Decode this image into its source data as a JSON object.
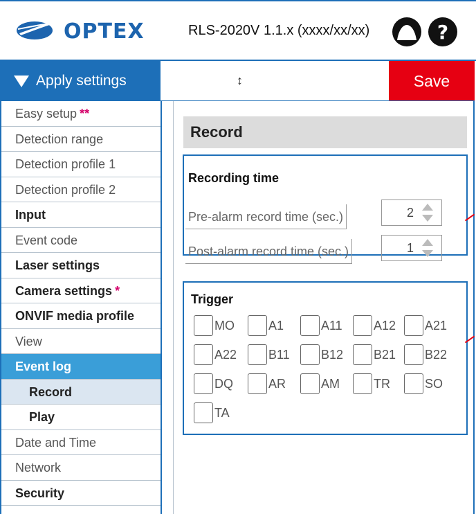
{
  "brand": {
    "name": "OPTEX",
    "color": "#1d64ae"
  },
  "header": {
    "model_version": "RLS-2020V 1.1.x (xxxx/xx/xx)"
  },
  "toolbar": {
    "apply_label": "Apply settings",
    "resize_glyph": "↕",
    "save_label": "Save"
  },
  "sidebar": {
    "items": [
      {
        "label": "Easy setup",
        "mark": "**",
        "style": "normal"
      },
      {
        "label": "Detection range",
        "mark": "",
        "style": "normal"
      },
      {
        "label": "Detection profile 1",
        "mark": "",
        "style": "normal"
      },
      {
        "label": "Detection profile 2",
        "mark": "",
        "style": "normal"
      },
      {
        "label": "Input",
        "mark": "",
        "style": "bold"
      },
      {
        "label": "Event code",
        "mark": "",
        "style": "normal"
      },
      {
        "label": "Laser settings",
        "mark": "",
        "style": "bold"
      },
      {
        "label": "Camera settings",
        "mark": "*",
        "style": "bold"
      },
      {
        "label": "ONVIF media profile",
        "mark": "",
        "style": "bold"
      },
      {
        "label": "View",
        "mark": "",
        "style": "normal"
      },
      {
        "label": "Event log",
        "mark": "",
        "style": "active"
      },
      {
        "label": "Record",
        "mark": "",
        "style": "sub-selected"
      },
      {
        "label": "Play",
        "mark": "",
        "style": "sub"
      },
      {
        "label": "Date and Time",
        "mark": "",
        "style": "normal"
      },
      {
        "label": "Network",
        "mark": "",
        "style": "normal"
      },
      {
        "label": "Security",
        "mark": "",
        "style": "bold"
      }
    ]
  },
  "page": {
    "title": "Record"
  },
  "recording_time": {
    "title": "Recording time",
    "pre_alarm_label": "Pre-alarm record time (sec.)",
    "pre_alarm_value": "2",
    "post_alarm_label": "Post-alarm record time (sec.)",
    "post_alarm_value": "1"
  },
  "trigger": {
    "title": "Trigger",
    "options": [
      "MO",
      "A1",
      "A11",
      "A12",
      "A21",
      "A22",
      "B11",
      "B12",
      "B21",
      "B22",
      "DQ",
      "AR",
      "AM",
      "TR",
      "SO",
      "TA"
    ]
  },
  "colors": {
    "accent": "#1d6fb8",
    "active_nav": "#3a9ed8",
    "save": "#e60012"
  },
  "icons": {
    "user": "user-circle-icon",
    "help": "help-question-icon"
  }
}
